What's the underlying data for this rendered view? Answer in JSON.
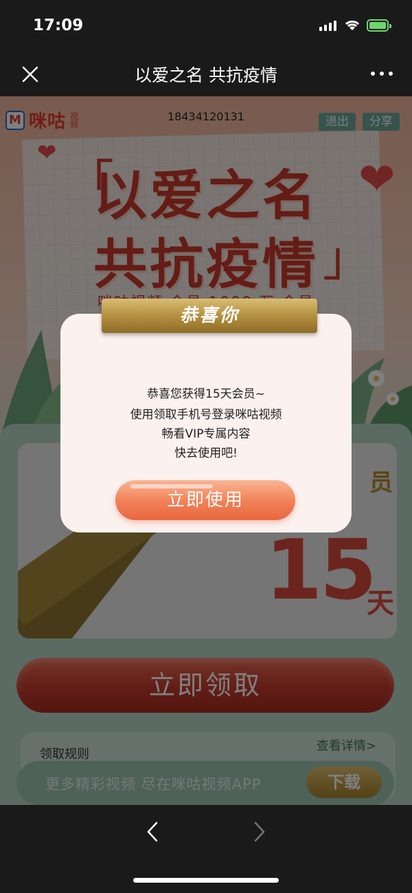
{
  "status_bar": {
    "time": "17:09"
  },
  "nav": {
    "title": "以爱之名 共抗疫情"
  },
  "page": {
    "brand_name": "咪咕",
    "brand_tag": "视频",
    "phone": "18434120131",
    "logout_label": "退出",
    "share_label": "分享",
    "headline_line1": "以爱之名",
    "headline_line2": "共抗疫情",
    "bracket_open": "「",
    "bracket_close": "」",
    "subline": "咪咕视频 会员 1000 万 会员",
    "card_suffix": "员",
    "card_number": "15",
    "card_unit": "天",
    "claim_label": "立即领取",
    "rules_label": "领取规则",
    "details_label": "查看详情>",
    "download_text": "更多精彩视频 尽在咪咕视频APP",
    "download_button": "下载"
  },
  "modal": {
    "ribbon": "恭喜你",
    "line1": "恭喜您获得15天会员~",
    "line2": "使用领取手机号登录咪咕视频",
    "line3": "畅看VIP专属内容",
    "line4": "快去使用吧!",
    "button": "立即使用"
  },
  "colors": {
    "accent_red": "#c93a2c",
    "modal_button": "#f28459",
    "ribbon_gold": "#b08c3c",
    "battery_green": "#6cd66c"
  },
  "icons": [
    "close-icon",
    "more-icon",
    "back-arrow-icon",
    "forward-arrow-icon",
    "signal-icon",
    "wifi-icon",
    "battery-icon"
  ]
}
